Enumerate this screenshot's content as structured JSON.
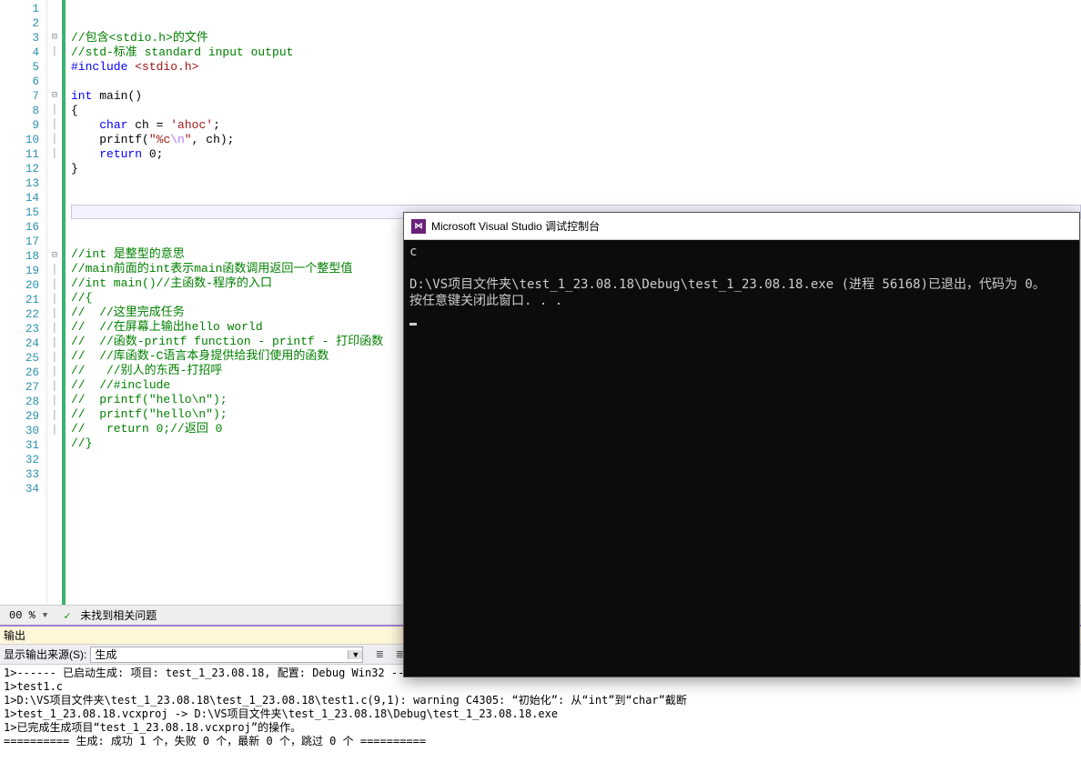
{
  "editor": {
    "line_start": 1,
    "line_end": 34,
    "lines": [
      {
        "n": 1,
        "fold": "",
        "tokens": []
      },
      {
        "n": 2,
        "fold": "",
        "tokens": []
      },
      {
        "n": 3,
        "fold": "⊟",
        "tokens": [
          {
            "c": "tok-comment",
            "t": "//包含<stdio.h>的文件"
          }
        ]
      },
      {
        "n": 4,
        "fold": "│",
        "tokens": [
          {
            "c": "tok-comment",
            "t": "//std-标准 standard input output"
          }
        ]
      },
      {
        "n": 5,
        "fold": "",
        "tokens": [
          {
            "c": "tok-keyword",
            "t": "#include "
          },
          {
            "c": "tok-string",
            "t": "<stdio.h>"
          }
        ]
      },
      {
        "n": 6,
        "fold": "",
        "tokens": []
      },
      {
        "n": 7,
        "fold": "⊟",
        "tokens": [
          {
            "c": "tok-type",
            "t": "int"
          },
          {
            "c": "",
            "t": " "
          },
          {
            "c": "tok-func",
            "t": "main"
          },
          {
            "c": "tok-punc",
            "t": "()"
          }
        ]
      },
      {
        "n": 8,
        "fold": "│",
        "tokens": [
          {
            "c": "tok-punc",
            "t": "{"
          }
        ]
      },
      {
        "n": 9,
        "fold": "│",
        "tokens": [
          {
            "c": "",
            "t": "    "
          },
          {
            "c": "tok-type",
            "t": "char"
          },
          {
            "c": "",
            "t": " ch = "
          },
          {
            "c": "tok-char",
            "t": "'ahoc'"
          },
          {
            "c": "tok-punc",
            "t": ";"
          }
        ]
      },
      {
        "n": 10,
        "fold": "│",
        "tokens": [
          {
            "c": "",
            "t": "    "
          },
          {
            "c": "tok-func",
            "t": "printf"
          },
          {
            "c": "tok-punc",
            "t": "("
          },
          {
            "c": "tok-string",
            "t": "\"%c"
          },
          {
            "c": "tok-escape",
            "t": "\\n"
          },
          {
            "c": "tok-string",
            "t": "\""
          },
          {
            "c": "tok-punc",
            "t": ", ch);"
          }
        ]
      },
      {
        "n": 11,
        "fold": "│",
        "tokens": [
          {
            "c": "",
            "t": "    "
          },
          {
            "c": "tok-keyword",
            "t": "return"
          },
          {
            "c": "",
            "t": " "
          },
          {
            "c": "tok-num",
            "t": "0"
          },
          {
            "c": "tok-punc",
            "t": ";"
          }
        ]
      },
      {
        "n": 12,
        "fold": "",
        "tokens": [
          {
            "c": "tok-punc",
            "t": "}"
          }
        ]
      },
      {
        "n": 13,
        "fold": "",
        "tokens": []
      },
      {
        "n": 14,
        "fold": "",
        "tokens": []
      },
      {
        "n": 15,
        "fold": "",
        "hl": true,
        "tokens": []
      },
      {
        "n": 16,
        "fold": "",
        "tokens": []
      },
      {
        "n": 17,
        "fold": "",
        "tokens": []
      },
      {
        "n": 18,
        "fold": "⊟",
        "tokens": [
          {
            "c": "tok-comment",
            "t": "//int 是整型的意思"
          }
        ]
      },
      {
        "n": 19,
        "fold": "│",
        "tokens": [
          {
            "c": "tok-comment",
            "t": "//main前面的int表示main函数调用返回一个整型值"
          }
        ]
      },
      {
        "n": 20,
        "fold": "│",
        "tokens": [
          {
            "c": "tok-comment",
            "t": "//int main()//主函数-程序的入口"
          }
        ]
      },
      {
        "n": 21,
        "fold": "│",
        "tokens": [
          {
            "c": "tok-comment",
            "t": "//{"
          }
        ]
      },
      {
        "n": 22,
        "fold": "│",
        "tokens": [
          {
            "c": "tok-comment",
            "t": "//  //这里完成任务"
          }
        ]
      },
      {
        "n": 23,
        "fold": "│",
        "tokens": [
          {
            "c": "tok-comment",
            "t": "//  //在屏幕上输出hello world"
          }
        ]
      },
      {
        "n": 24,
        "fold": "│",
        "tokens": [
          {
            "c": "tok-comment",
            "t": "//  //函数-printf function - printf - 打印函数"
          }
        ]
      },
      {
        "n": 25,
        "fold": "│",
        "tokens": [
          {
            "c": "tok-comment",
            "t": "//  //库函数-C语言本身提供给我们使用的函数"
          }
        ]
      },
      {
        "n": 26,
        "fold": "│",
        "tokens": [
          {
            "c": "tok-comment",
            "t": "//   //别人的东西-打招呼"
          }
        ]
      },
      {
        "n": 27,
        "fold": "│",
        "tokens": [
          {
            "c": "tok-comment",
            "t": "//  //#include"
          }
        ]
      },
      {
        "n": 28,
        "fold": "│",
        "tokens": [
          {
            "c": "tok-comment",
            "t": "//  printf(\"hello\\n\");"
          }
        ]
      },
      {
        "n": 29,
        "fold": "│",
        "tokens": [
          {
            "c": "tok-comment",
            "t": "//  printf(\"hello\\n\");"
          }
        ]
      },
      {
        "n": 30,
        "fold": "│",
        "tokens": [
          {
            "c": "tok-comment",
            "t": "//   return 0;//返回 0"
          }
        ]
      },
      {
        "n": 31,
        "fold": "",
        "tokens": [
          {
            "c": "tok-comment",
            "t": "//}"
          }
        ]
      },
      {
        "n": 32,
        "fold": "",
        "tokens": []
      },
      {
        "n": 33,
        "fold": "",
        "tokens": []
      },
      {
        "n": 34,
        "fold": "",
        "tokens": []
      }
    ]
  },
  "statusbar": {
    "zoom": "00 %",
    "issues": "未找到相关问题"
  },
  "output": {
    "tab": "输出",
    "source_label": "显示输出来源(S):",
    "source_value": "生成",
    "lines": [
      "1>------ 已启动生成: 项目: test_1_23.08.18, 配置: Debug Win32 ------",
      "1>test1.c",
      "1>D:\\VS项目文件夹\\test_1_23.08.18\\test_1_23.08.18\\test1.c(9,1): warning C4305: “初始化”: 从“int”到“char”截断",
      "1>test_1_23.08.18.vcxproj -> D:\\VS项目文件夹\\test_1_23.08.18\\Debug\\test_1_23.08.18.exe",
      "1>已完成生成项目“test_1_23.08.18.vcxproj”的操作。",
      "========== 生成: 成功 1 个，失败 0 个，最新 0 个，跳过 0 个 =========="
    ]
  },
  "console": {
    "title": "Microsoft Visual Studio 调试控制台",
    "body": "c\n\nD:\\VS项目文件夹\\test_1_23.08.18\\Debug\\test_1_23.08.18.exe (进程 56168)已退出，代码为 0。\n按任意键关闭此窗口. . .\n"
  }
}
